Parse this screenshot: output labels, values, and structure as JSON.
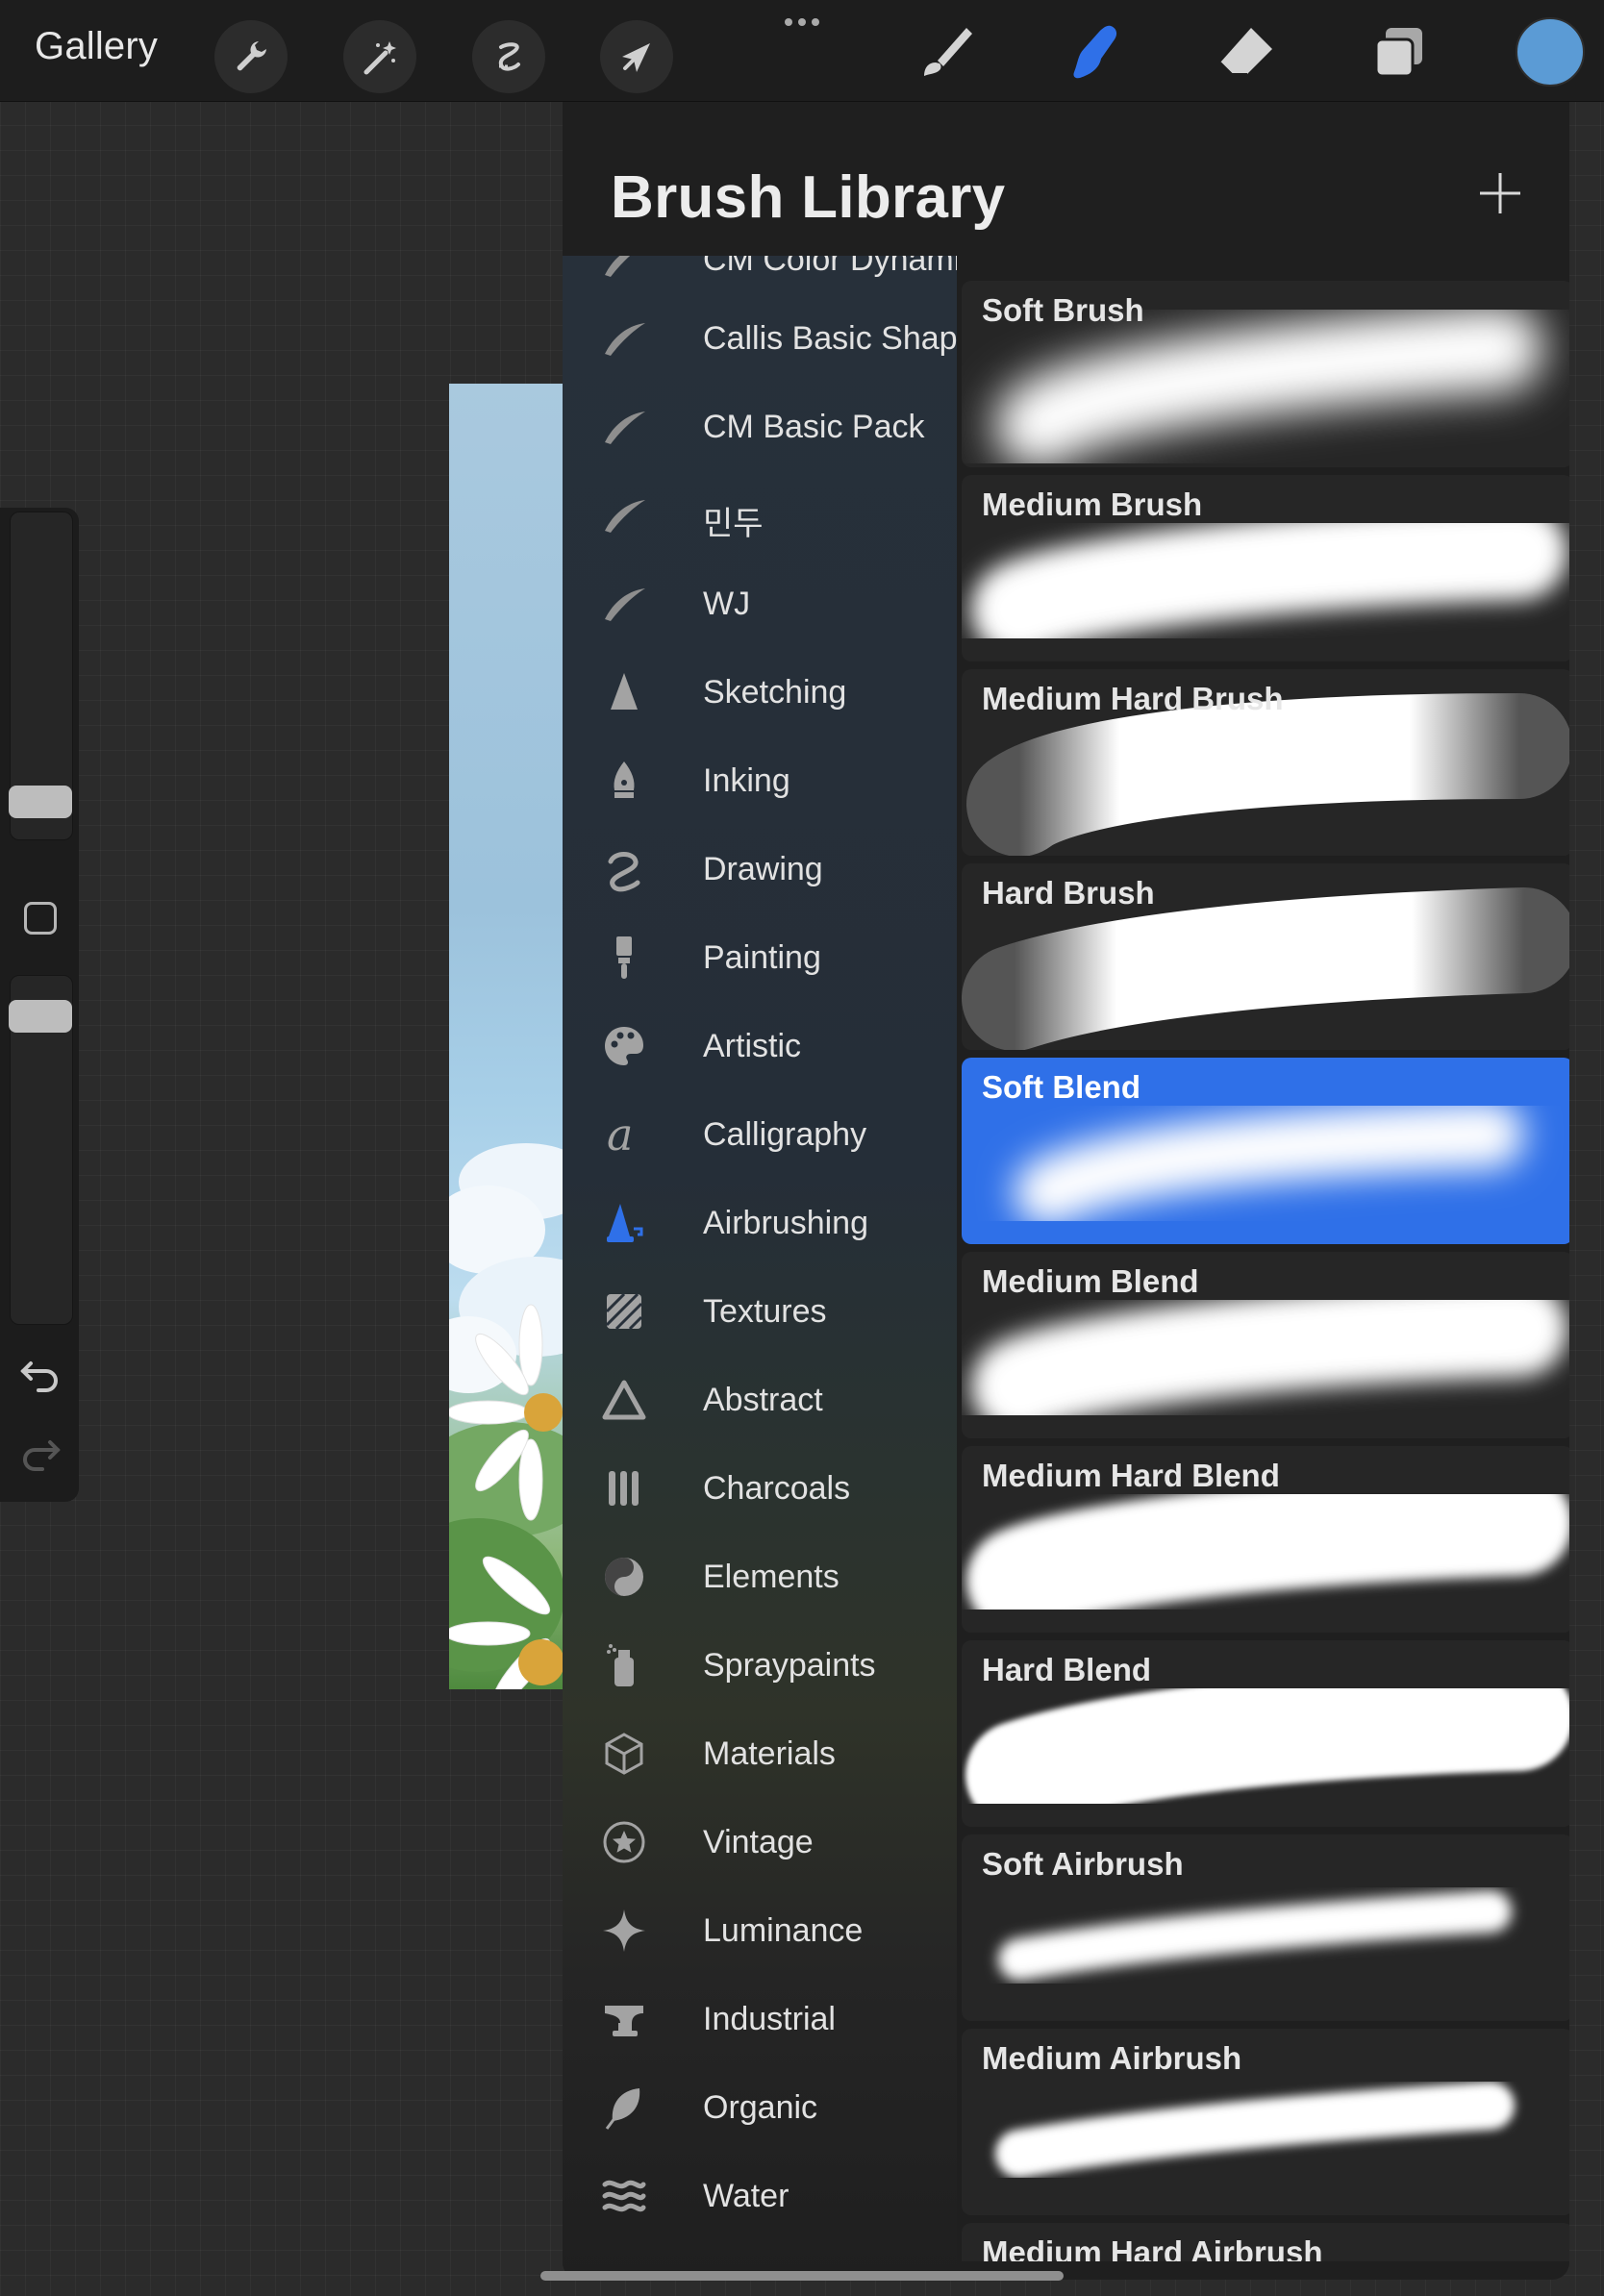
{
  "topbar": {
    "gallery_label": "Gallery",
    "tools": [
      {
        "name": "actions",
        "icon": "wrench-icon"
      },
      {
        "name": "adjustments",
        "icon": "magic-wand-icon"
      },
      {
        "name": "selection",
        "icon": "selection-s-icon"
      },
      {
        "name": "transform",
        "icon": "arrow-cursor-icon"
      }
    ],
    "right_tools": [
      {
        "name": "paint",
        "icon": "brush-icon",
        "active": false
      },
      {
        "name": "smudge",
        "icon": "smudge-finger-icon",
        "active": true
      },
      {
        "name": "erase",
        "icon": "eraser-icon",
        "active": false
      },
      {
        "name": "layers",
        "icon": "layers-icon",
        "active": false
      }
    ],
    "current_color": "#5b9bd5",
    "accent_color": "#2f70e8"
  },
  "sidebar": {
    "size_slider_level": 0.05,
    "opacity_slider_level": 0.95
  },
  "brush_library": {
    "title": "Brush Library",
    "add_button_icon": "plus-icon",
    "sets": [
      {
        "label": "CM Color Dynamics",
        "icon": "brush-stroke-icon"
      },
      {
        "label": "Callis Basic Shape",
        "icon": "brush-stroke-icon"
      },
      {
        "label": "CM Basic Pack",
        "icon": "brush-stroke-icon"
      },
      {
        "label": "민두",
        "icon": "brush-stroke-icon"
      },
      {
        "label": "WJ",
        "icon": "brush-stroke-icon"
      },
      {
        "label": "Sketching",
        "icon": "pencil-tip-icon"
      },
      {
        "label": "Inking",
        "icon": "pen-nib-icon"
      },
      {
        "label": "Drawing",
        "icon": "squiggle-icon"
      },
      {
        "label": "Painting",
        "icon": "paintbrush-icon"
      },
      {
        "label": "Artistic",
        "icon": "palette-icon"
      },
      {
        "label": "Calligraphy",
        "icon": "calligraphy-a-icon"
      },
      {
        "label": "Airbrushing",
        "icon": "airbrush-icon",
        "selected": true
      },
      {
        "label": "Textures",
        "icon": "texture-icon"
      },
      {
        "label": "Abstract",
        "icon": "triangle-icon"
      },
      {
        "label": "Charcoals",
        "icon": "charcoal-sticks-icon"
      },
      {
        "label": "Elements",
        "icon": "yin-yang-icon"
      },
      {
        "label": "Spraypaints",
        "icon": "spray-can-icon"
      },
      {
        "label": "Materials",
        "icon": "cube-icon"
      },
      {
        "label": "Vintage",
        "icon": "star-badge-icon"
      },
      {
        "label": "Luminance",
        "icon": "sparkle-icon"
      },
      {
        "label": "Industrial",
        "icon": "anvil-icon"
      },
      {
        "label": "Organic",
        "icon": "leaf-icon"
      },
      {
        "label": "Water",
        "icon": "waves-icon"
      }
    ],
    "brushes": [
      {
        "name": "Soft Brush",
        "selected": false
      },
      {
        "name": "Medium Brush",
        "selected": false
      },
      {
        "name": "Medium Hard Brush",
        "selected": false
      },
      {
        "name": "Hard Brush",
        "selected": false
      },
      {
        "name": "Soft Blend",
        "selected": true
      },
      {
        "name": "Medium Blend",
        "selected": false
      },
      {
        "name": "Medium Hard Blend",
        "selected": false
      },
      {
        "name": "Hard Blend",
        "selected": false
      },
      {
        "name": "Soft Airbrush",
        "selected": false
      },
      {
        "name": "Medium Airbrush",
        "selected": false
      },
      {
        "name": "Medium Hard Airbrush",
        "selected": false
      }
    ]
  }
}
